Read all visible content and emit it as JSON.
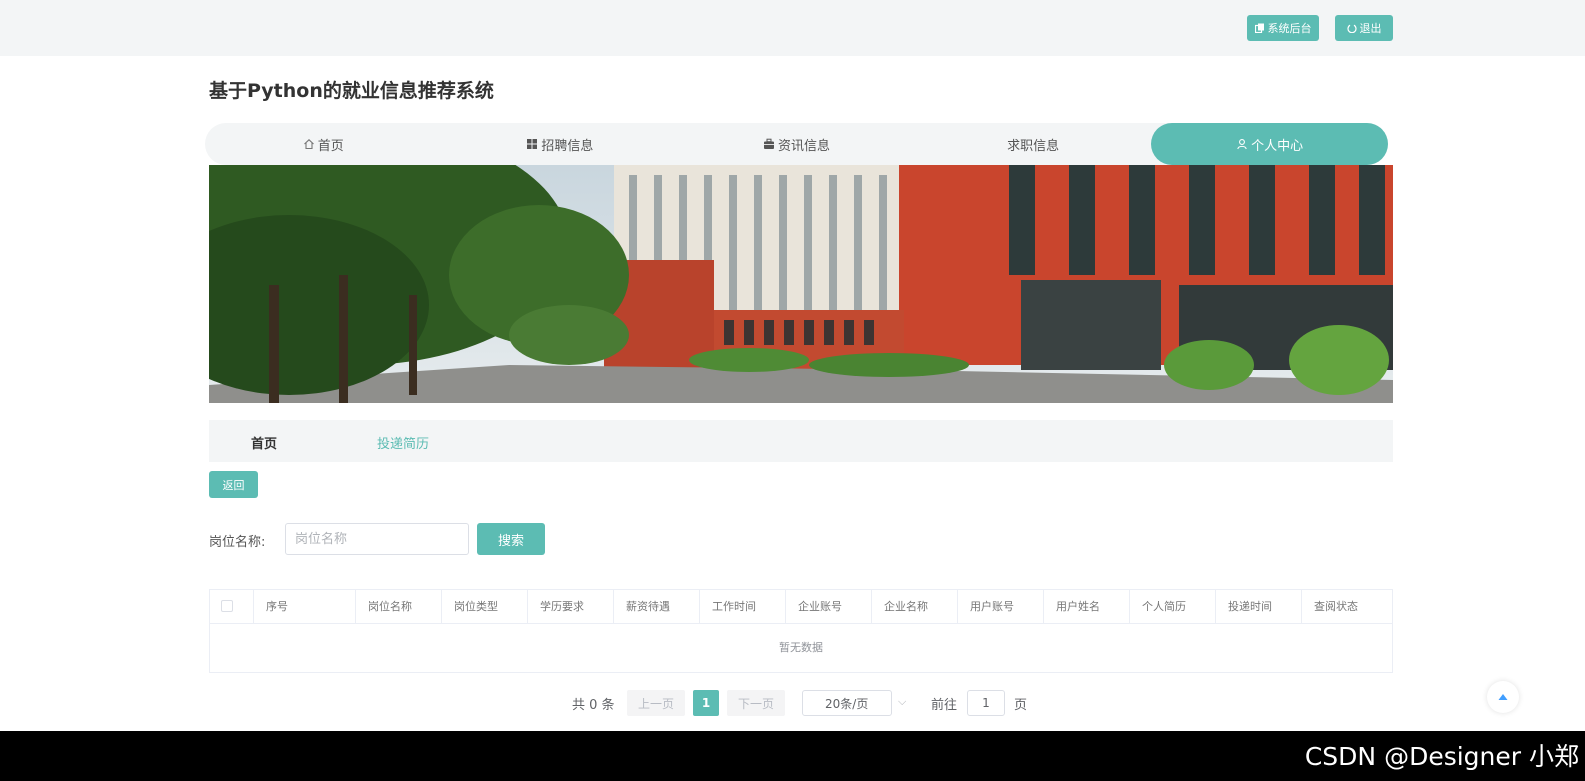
{
  "topbar": {
    "backend_label": "系统后台",
    "logout_label": "退出"
  },
  "site": {
    "title": "基于Python的就业信息推荐系统"
  },
  "nav": {
    "items": [
      {
        "label": "首页",
        "icon": "home-icon"
      },
      {
        "label": "招聘信息",
        "icon": "grid-icon"
      },
      {
        "label": "资讯信息",
        "icon": "briefcase-icon"
      },
      {
        "label": "求职信息",
        "icon": ""
      },
      {
        "label": "个人中心",
        "icon": "user-icon",
        "active": true
      }
    ]
  },
  "subtabs": {
    "home": "首页",
    "resume": "投递简历"
  },
  "back_button": "返回",
  "search": {
    "label": "岗位名称:",
    "placeholder": "岗位名称",
    "value": "",
    "button": "搜索"
  },
  "table": {
    "headers": [
      "序号",
      "岗位名称",
      "岗位类型",
      "学历要求",
      "薪资待遇",
      "工作时间",
      "企业账号",
      "企业名称",
      "用户账号",
      "用户姓名",
      "个人简历",
      "投递时间",
      "查阅状态"
    ],
    "rows": [],
    "empty_text": "暂无数据"
  },
  "pagination": {
    "total_text": "共 0 条",
    "prev": "上一页",
    "current": "1",
    "next": "下一页",
    "page_size": "20条/页",
    "goto_label": "前往",
    "goto_value": "1",
    "page_unit": "页"
  },
  "watermark": "CSDN @Designer 小郑",
  "colors": {
    "accent": "#5cbcb3",
    "topbar_bg": "#f3f5f6"
  }
}
